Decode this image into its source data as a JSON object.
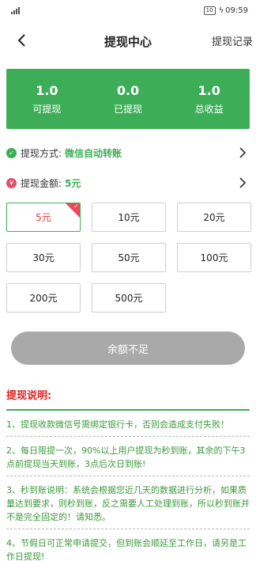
{
  "status_bar": {
    "battery": "10",
    "time": "09:59"
  },
  "nav": {
    "title": "提现中心",
    "right_link": "提现记录"
  },
  "summary": [
    {
      "value": "1.0",
      "label": "可提现"
    },
    {
      "value": "0.0",
      "label": "已提现"
    },
    {
      "value": "1.0",
      "label": "总收益"
    }
  ],
  "method": {
    "label": "提现方式:",
    "value": "微信自动转账"
  },
  "amount": {
    "label": "提现金额:",
    "value": "5元"
  },
  "amount_options": [
    "5元",
    "10元",
    "20元",
    "30元",
    "50元",
    "100元",
    "200元",
    "500元"
  ],
  "selected_amount_index": 0,
  "submit_label": "余额不足",
  "explanation": {
    "heading": "提现说明:",
    "items": [
      "1、提现收款微信号需绑定银行卡，否则会造成支付失败！",
      "2、每日限提一次，90%以上用户提现为秒到账，其余的下午3点前提现当天到账，3点后次日到账!",
      "3、秒到账说明：系统会根据您近几天的数据进行分析，如果质量达到要求，则秒到账，反之需要人工处理到账，所以秒到账并不是完全固定的！请知悉。",
      "4、节假日可正常申请提交，但到账会顺延至工作日，请另是工作日提现!"
    ]
  },
  "colors": {
    "accent": "#3dae57",
    "alert": "#e02020",
    "disabled": "#a9a9a9"
  }
}
